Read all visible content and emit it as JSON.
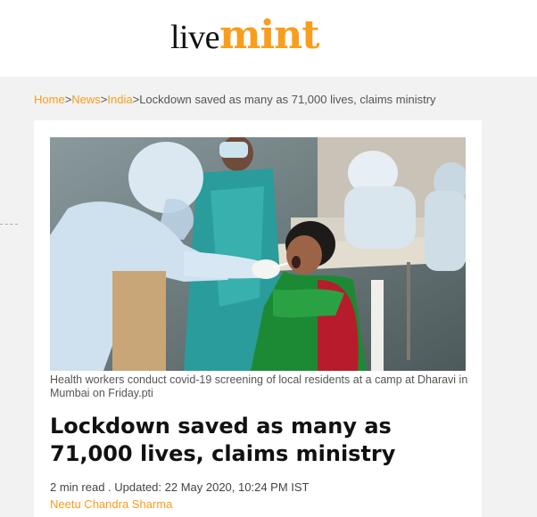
{
  "logo": {
    "part1": "live",
    "part2": "mint"
  },
  "breadcrumb": {
    "items": [
      "Home",
      "News",
      "India"
    ],
    "separator": ">",
    "current": "Lockdown saved as many as 71,000 lives, claims ministry"
  },
  "article": {
    "image_caption": "Health workers conduct covid-19 screening of local residents at a camp at Dharavi in Mumbai on Friday.pti",
    "headline": "Lockdown saved as many as 71,000 lives, claims ministry",
    "meta": "2 min read . Updated: 22 May 2020, 10:24 PM IST",
    "author": "Neetu Chandra Sharma"
  },
  "colors": {
    "accent": "#f99d1c",
    "background": "#f2f2f2",
    "text": "#111111"
  }
}
